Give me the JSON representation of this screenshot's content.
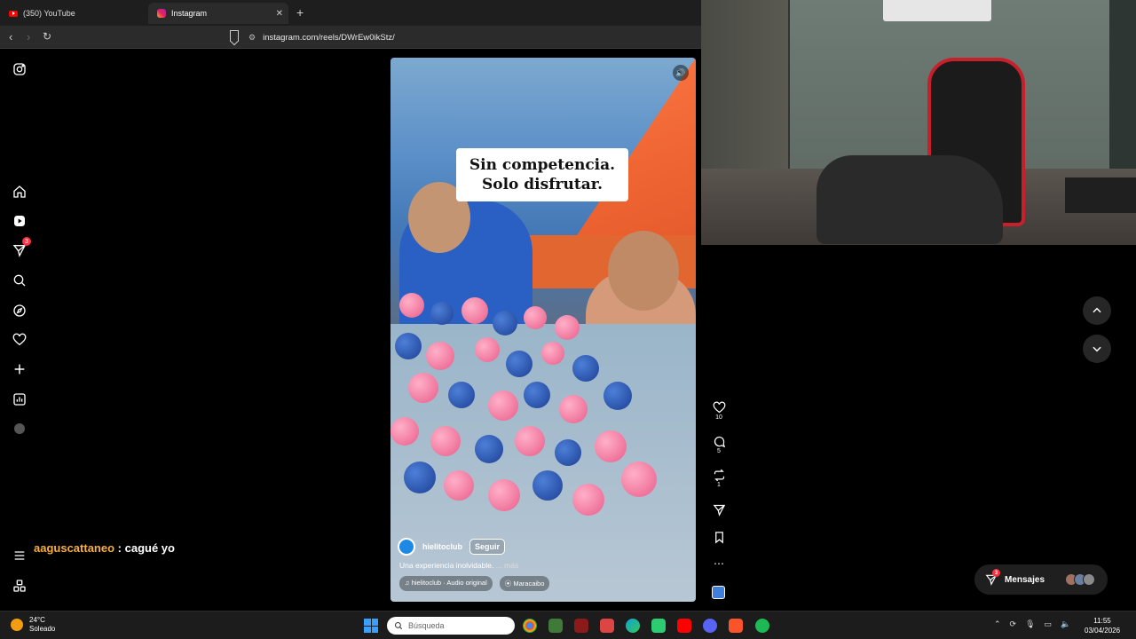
{
  "browser": {
    "tabs": [
      {
        "label": "(350) YouTube",
        "icon": "youtube-icon"
      },
      {
        "label": "Instagram",
        "icon": "instagram-icon",
        "active": true
      }
    ],
    "url": "instagram.com/reels/DWrEw0ikStz/"
  },
  "sidebar": {
    "notifications_badge": "3",
    "items": [
      "home-icon",
      "reels-icon",
      "direct-icon",
      "search-icon",
      "explore-icon",
      "heart-icon",
      "create-icon",
      "dashboard-icon",
      "profile-icon"
    ]
  },
  "chat": {
    "user": "aaguscattaneo",
    "separator": " : ",
    "message": "cagué yo"
  },
  "reel": {
    "caption_line1": "Sin competencia.",
    "caption_line2": "Solo disfrutar.",
    "username": "hielitoclub",
    "follow_label": "Seguir",
    "description": "Una experiencia inolvidable.",
    "more_label": "... más",
    "audio": "hielitoclub · Audio original",
    "location": "Maracaibo"
  },
  "actions": {
    "likes": "10",
    "comments": "5",
    "reposts": "1"
  },
  "messages": {
    "label": "Mensajes",
    "badge": "3"
  },
  "taskbar": {
    "temperature": "24°C",
    "condition": "Soleado",
    "search_placeholder": "Búsqueda",
    "time": "11:55",
    "date": "03/04/2026"
  },
  "colors": {
    "chat_username": "#f5b041",
    "badge": "#ff3040",
    "background": "#000000"
  }
}
